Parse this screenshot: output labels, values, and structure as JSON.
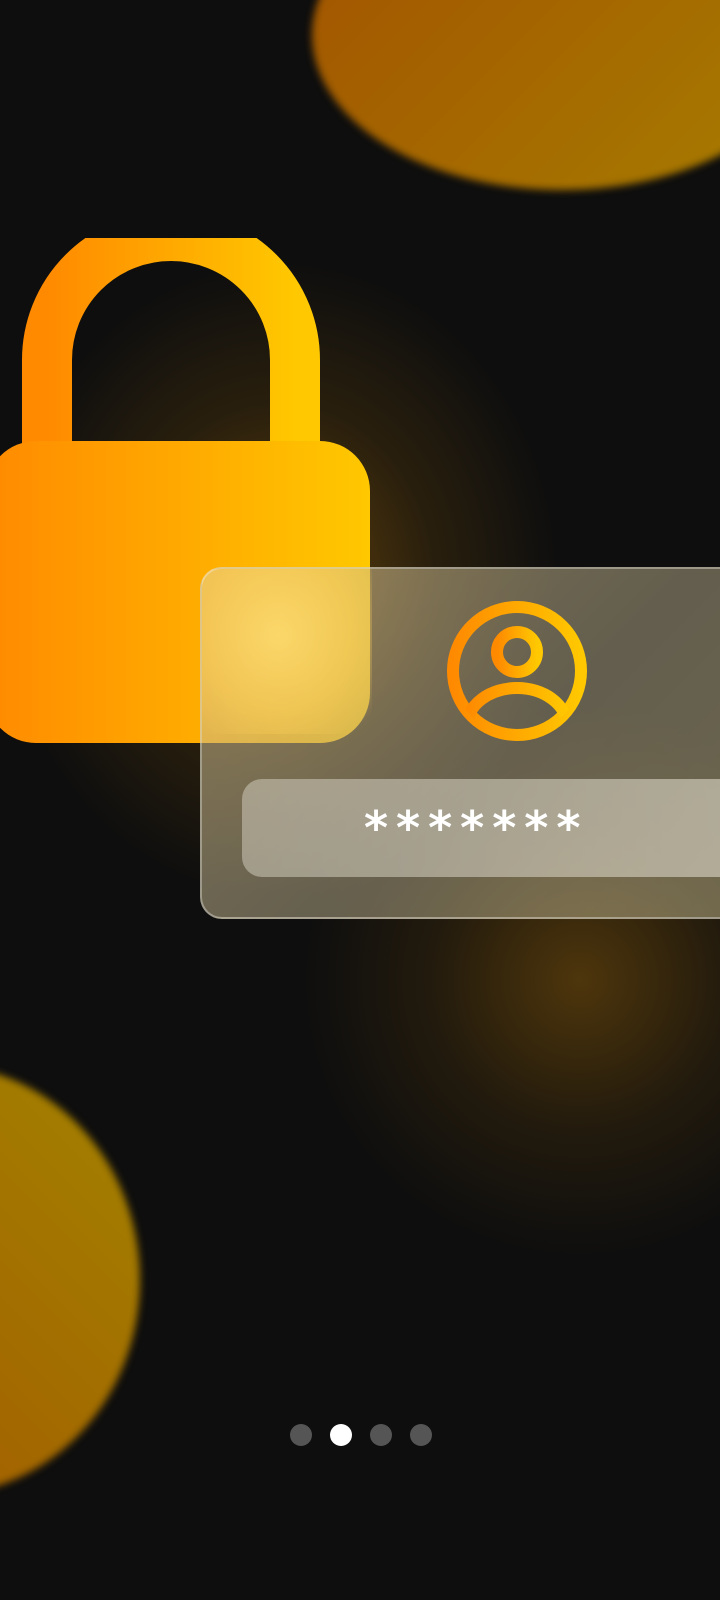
{
  "colors": {
    "background": "#0e0e0e",
    "accent_start": "#ff8a00",
    "accent_end": "#ffc800",
    "dot_active": "#ffffff",
    "dot_inactive": "#555555"
  },
  "illustration": {
    "lock_icon": "lock-icon",
    "card_icon": "user-circle-icon",
    "password_mask": "*******"
  },
  "pager": {
    "total": 4,
    "active_index": 1,
    "dots": [
      {
        "state": "inactive"
      },
      {
        "state": "active"
      },
      {
        "state": "inactive"
      },
      {
        "state": "inactive"
      }
    ]
  }
}
